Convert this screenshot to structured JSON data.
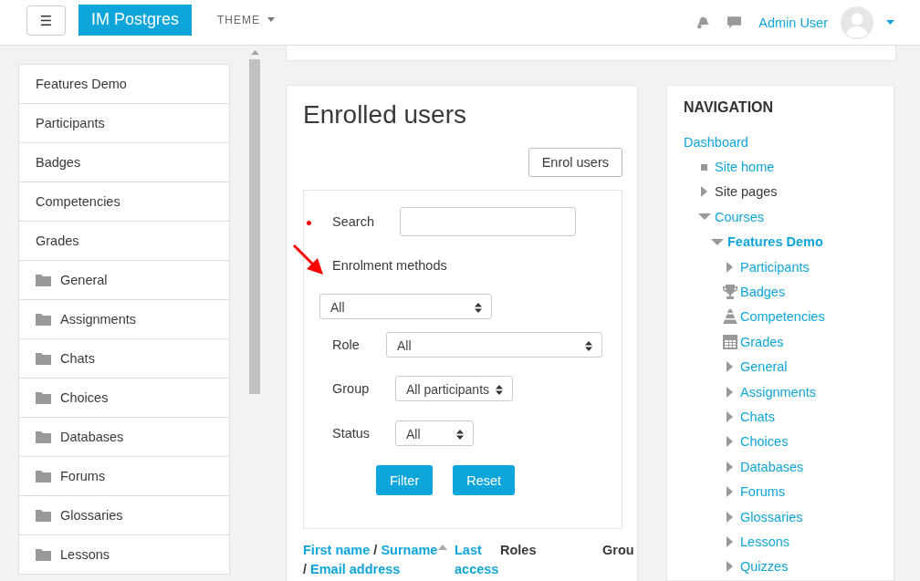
{
  "navbar": {
    "menu_button": "☰",
    "brand": "IM Postgres",
    "theme_menu": "THEME",
    "user_name": "Admin User"
  },
  "drawer": {
    "items": [
      {
        "label": "Features Demo",
        "kind": "plain"
      },
      {
        "label": "Participants",
        "kind": "plain"
      },
      {
        "label": "Badges",
        "kind": "plain"
      },
      {
        "label": "Competencies",
        "kind": "plain"
      },
      {
        "label": "Grades",
        "kind": "plain"
      },
      {
        "label": "General",
        "kind": "folder"
      },
      {
        "label": "Assignments",
        "kind": "folder"
      },
      {
        "label": "Chats",
        "kind": "folder"
      },
      {
        "label": "Choices",
        "kind": "folder"
      },
      {
        "label": "Databases",
        "kind": "folder"
      },
      {
        "label": "Forums",
        "kind": "folder"
      },
      {
        "label": "Glossaries",
        "kind": "folder"
      },
      {
        "label": "Lessons",
        "kind": "folder"
      }
    ]
  },
  "main": {
    "title": "Enrolled users",
    "enrol_button": "Enrol users",
    "filter": {
      "search_label": "Search",
      "enrolment_label": "Enrolment methods",
      "enrolment_value": "All",
      "role_label": "Role",
      "role_value": "All",
      "group_label": "Group",
      "group_value": "All participants",
      "status_label": "Status",
      "status_value": "All",
      "filter_button": "Filter",
      "reset_button": "Reset"
    },
    "table": {
      "column_1": [
        {
          "text": "First name",
          "kind": "link",
          "sorted": false
        },
        {
          "text": "/",
          "kind": "separator"
        },
        {
          "text": "Surname",
          "kind": "link",
          "sorted": true
        },
        {
          "text": "/",
          "kind": "separator"
        },
        {
          "text": "Email address",
          "kind": "link",
          "sorted": false
        }
      ],
      "column_2": "Last access",
      "column_3": "Roles",
      "column_4": "Grou"
    }
  },
  "navigation": {
    "title": "NAVIGATION",
    "items": [
      {
        "label": "Dashboard",
        "kind": "link",
        "link": true,
        "active": false,
        "children": [
          {
            "label": "Site home",
            "kind": "page",
            "link": true,
            "active": false
          },
          {
            "label": "Site pages",
            "kind": "node",
            "expanded": false,
            "link": false,
            "active": false
          },
          {
            "label": "Courses",
            "kind": "node",
            "expanded": true,
            "link": true,
            "active": false,
            "children": [
              {
                "label": "Features Demo",
                "kind": "node",
                "expanded": true,
                "link": true,
                "active": true,
                "children": [
                  {
                    "label": "Participants",
                    "kind": "node",
                    "expanded": false,
                    "link": true,
                    "active": false
                  },
                  {
                    "label": "Badges",
                    "kind": "badge",
                    "link": true,
                    "active": false
                  },
                  {
                    "label": "Competencies",
                    "kind": "competency",
                    "link": true,
                    "active": false
                  },
                  {
                    "label": "Grades",
                    "kind": "grade",
                    "link": true,
                    "active": false
                  },
                  {
                    "label": "General",
                    "kind": "node",
                    "expanded": false,
                    "link": true,
                    "active": false
                  },
                  {
                    "label": "Assignments",
                    "kind": "node",
                    "expanded": false,
                    "link": true,
                    "active": false
                  },
                  {
                    "label": "Chats",
                    "kind": "node",
                    "expanded": false,
                    "link": true,
                    "active": false
                  },
                  {
                    "label": "Choices",
                    "kind": "node",
                    "expanded": false,
                    "link": true,
                    "active": false
                  },
                  {
                    "label": "Databases",
                    "kind": "node",
                    "expanded": false,
                    "link": true,
                    "active": false
                  },
                  {
                    "label": "Forums",
                    "kind": "node",
                    "expanded": false,
                    "link": true,
                    "active": false
                  },
                  {
                    "label": "Glossaries",
                    "kind": "node",
                    "expanded": false,
                    "link": true,
                    "active": false
                  },
                  {
                    "label": "Lessons",
                    "kind": "node",
                    "expanded": false,
                    "link": true,
                    "active": false
                  },
                  {
                    "label": "Quizzes",
                    "kind": "node",
                    "expanded": false,
                    "link": true,
                    "active": false
                  }
                ]
              }
            ]
          }
        ]
      }
    ]
  }
}
